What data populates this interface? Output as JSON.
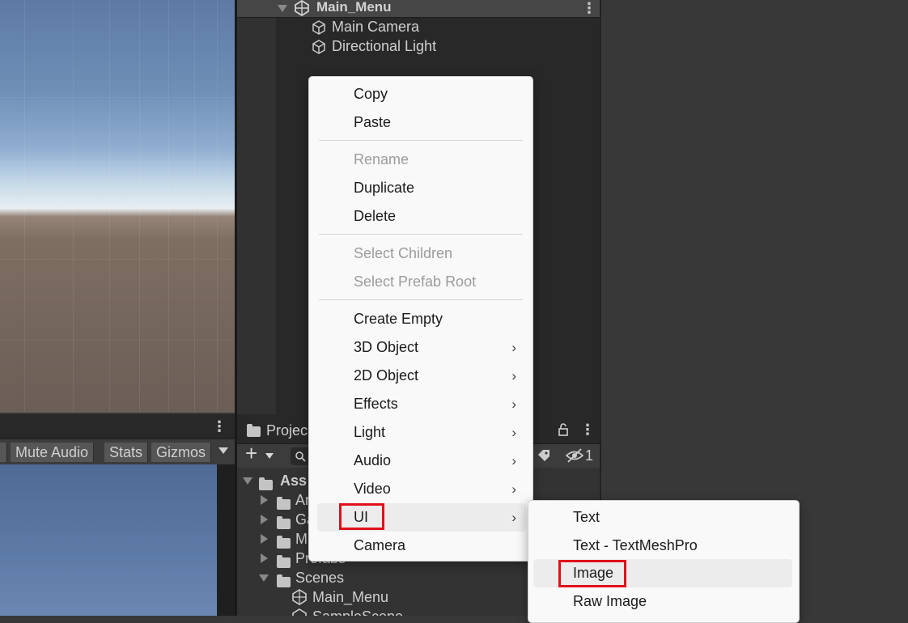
{
  "hierarchy": {
    "scene_name": "Main_Menu",
    "items": [
      {
        "label": "Main Camera",
        "icon": "gameobject-cube-icon"
      },
      {
        "label": "Directional Light",
        "icon": "gameobject-cube-icon"
      }
    ]
  },
  "game_toolbar": {
    "mute_audio": "Mute Audio",
    "stats": "Stats",
    "gizmos": "Gizmos"
  },
  "project": {
    "tab_label": "Projec",
    "hidden_count": "1",
    "tree": [
      {
        "label": "Ass",
        "type": "folder-open",
        "bold": true
      },
      {
        "label": "Ar",
        "type": "folder"
      },
      {
        "label": "Ga",
        "type": "folder"
      },
      {
        "label": "M",
        "type": "folder"
      },
      {
        "label": "Prefabs",
        "type": "folder"
      },
      {
        "label": "Scenes",
        "type": "folder-open"
      },
      {
        "label": "Main_Menu",
        "type": "scene"
      },
      {
        "label": "SampleScene",
        "type": "scene"
      }
    ]
  },
  "context_menu": {
    "copy": "Copy",
    "paste": "Paste",
    "rename": "Rename",
    "duplicate": "Duplicate",
    "delete": "Delete",
    "select_children": "Select Children",
    "select_prefab_root": "Select Prefab Root",
    "create_empty": "Create Empty",
    "object_3d": "3D Object",
    "object_2d": "2D Object",
    "effects": "Effects",
    "light": "Light",
    "audio": "Audio",
    "video": "Video",
    "ui": "UI",
    "camera": "Camera"
  },
  "ui_submenu": {
    "text": "Text",
    "text_tmp": "Text - TextMeshPro",
    "image": "Image",
    "raw_image": "Raw Image"
  },
  "colors": {
    "highlight_box": "#e0101a",
    "menu_bg": "#f9f9f9",
    "editor_bg": "#282828"
  }
}
